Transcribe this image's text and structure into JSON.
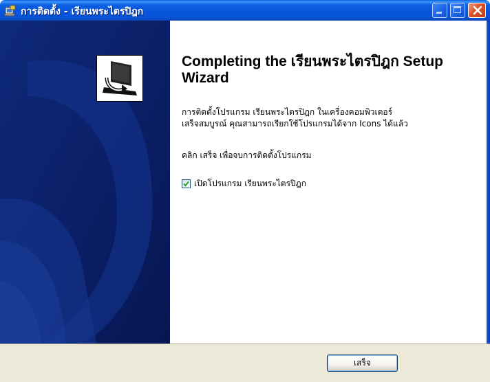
{
  "window": {
    "title": "การติดตั้ง - เรียนพระไตรปิฎก"
  },
  "icons": {
    "app": "installer-icon",
    "banner": "computer-install-icon"
  },
  "titlebar_buttons": [
    "minimize",
    "maximize",
    "close"
  ],
  "content": {
    "heading": "Completing the เรียนพระไตรปิฎก Setup Wizard",
    "description_line1": "การติดตั้งโปรแกรม เรียนพระไตรปิฎก ในเครื่องคอมพิวเตอร์",
    "description_line2": "เสร็จสมบูรณ์ คุณสามารถเรียกใช้โปรแกรมได้จาก Icons ได้แล้ว",
    "instruction": "คลิก เสร็จ เพื่อจบการติดตั้งโปรแกรม",
    "checkbox_label": "เปิดโปรแกรม เรียนพระไตรปิฎก",
    "checkbox_checked": true
  },
  "buttons": {
    "finish": "เสร็จ"
  },
  "colors": {
    "titlebar": "#0855dd",
    "banner_bg": "#0c2370",
    "button_face": "#ece9d8"
  }
}
